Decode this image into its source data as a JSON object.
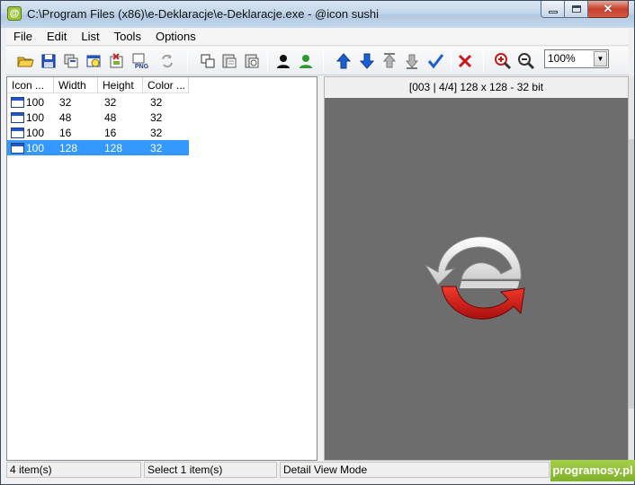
{
  "window": {
    "title": "C:\\Program Files (x86)\\e-Deklaracje\\e-Deklaracje.exe - @icon sushi",
    "app_icon_letter": "@"
  },
  "menu": [
    "File",
    "Edit",
    "List",
    "Tools",
    "Options"
  ],
  "toolbar": {
    "buttons": [
      "open-folder-icon",
      "save-icon",
      "copy-icons-icon",
      "extract-icon",
      "import-icon",
      "export-png-icon",
      "refresh-icon",
      "copy-icon",
      "paste-icon",
      "paste-special-icon",
      "black-bg-icon",
      "green-bg-icon",
      "move-up-icon",
      "move-down-icon",
      "move-top-icon",
      "move-bottom-icon",
      "check-icon",
      "delete-icon",
      "zoom-in-icon",
      "zoom-out-icon"
    ],
    "png_label": "PNG",
    "zoom_value": "100%"
  },
  "list": {
    "columns": [
      "Icon ...",
      "Width",
      "Height",
      "Color ..."
    ],
    "rows": [
      {
        "id": "100",
        "width": "32",
        "height": "32",
        "color": "32"
      },
      {
        "id": "100",
        "width": "48",
        "height": "48",
        "color": "32"
      },
      {
        "id": "100",
        "width": "16",
        "height": "16",
        "color": "32"
      },
      {
        "id": "100",
        "width": "128",
        "height": "128",
        "color": "32"
      }
    ],
    "selected_index": 3
  },
  "preview": {
    "info": "[003 | 4/4] 128 x 128 - 32 bit",
    "colors": {
      "bg": "#6d6d6d",
      "red": "#e01919",
      "white": "#ffffff"
    }
  },
  "status": {
    "items": "4 item(s)",
    "selection": "Select 1 item(s)",
    "mode": "Detail View Mode"
  },
  "watermark": "programosy.pl"
}
